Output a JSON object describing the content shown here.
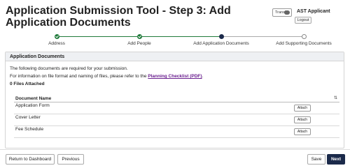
{
  "header": {
    "title": "Application Submission Tool - Step 3: Add Application Documents",
    "translate_label": "Transl",
    "user_name": "AST Applicant",
    "logout_label": "Logout"
  },
  "stepper": {
    "steps": [
      {
        "label": "Address",
        "status": "done"
      },
      {
        "label": "Add People",
        "status": "done"
      },
      {
        "label": "Add Application Documents",
        "status": "current"
      },
      {
        "label": "Add Supporting Documents",
        "status": "todo"
      }
    ]
  },
  "panel": {
    "title": "Application Documents",
    "required_text": "The following documents are required for your submission.",
    "info_prefix": "For information on file format and naming of files, please refer to the ",
    "info_link": "Planning Checklist (PDF)",
    "info_suffix": ".",
    "files_attached": "0 Files Attached",
    "table": {
      "column_header": "Document Name",
      "rows": [
        {
          "name": "Application Form",
          "action": "Attach"
        },
        {
          "name": "Cover Letter",
          "action": "Attach"
        },
        {
          "name": "Fee Schedule",
          "action": "Attach"
        }
      ]
    }
  },
  "footer": {
    "return_label": "Return to Dashboard",
    "previous_label": "Previous",
    "save_label": "Save",
    "next_label": "Next"
  }
}
